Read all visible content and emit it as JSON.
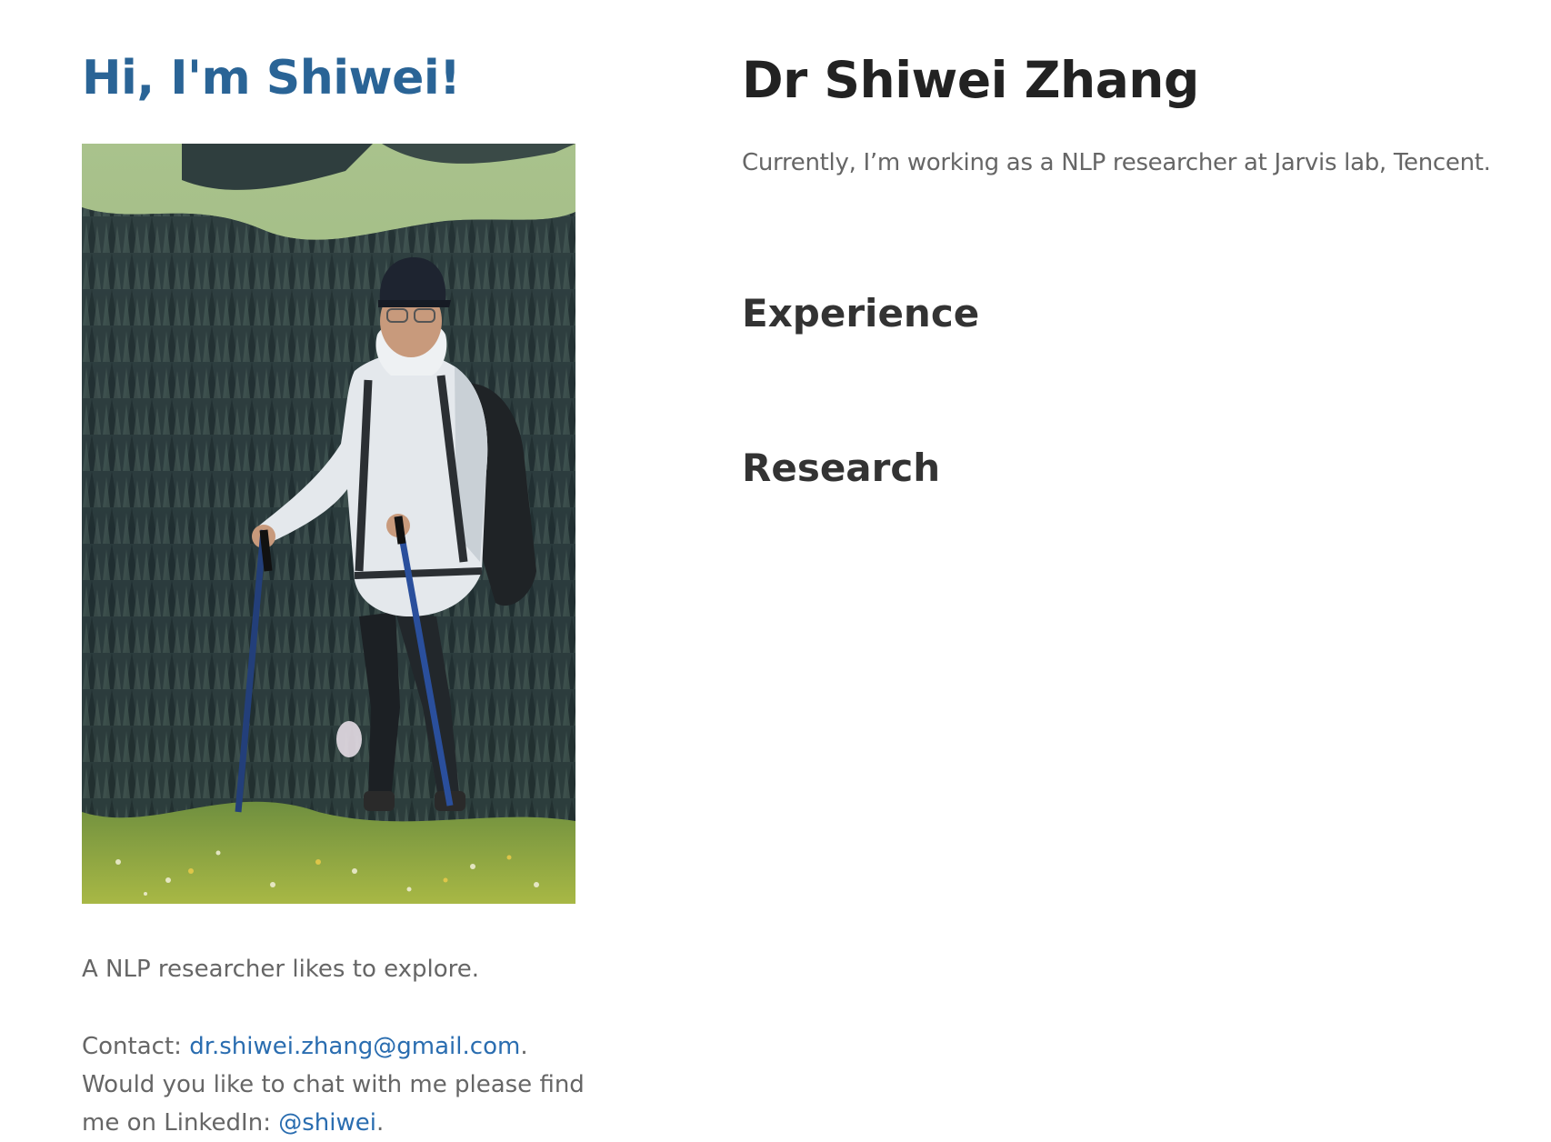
{
  "sidebar": {
    "title": "Hi, I'm Shiwei!",
    "tagline": "A NLP researcher likes to explore.",
    "contact": {
      "prefix": "Contact: ",
      "email": "dr.shiwei.zhang@gmail.com",
      "after_email": ".",
      "line2": " Would you like to chat with me please find me on LinkedIn: ",
      "linkedin": "@shiwei",
      "end": "."
    }
  },
  "main": {
    "title": "Dr Shiwei Zhang",
    "intro": "Currently, I’m working as a NLP researcher at Jarvis lab, Tencent.",
    "sections": [
      {
        "heading": "Experience"
      },
      {
        "heading": "Research"
      }
    ]
  },
  "colors": {
    "accent": "#2a6496",
    "link": "#2a6db0",
    "text_muted": "#666666",
    "heading": "#222222"
  },
  "icons": {
    "profile_photo": "hiker-photo"
  }
}
